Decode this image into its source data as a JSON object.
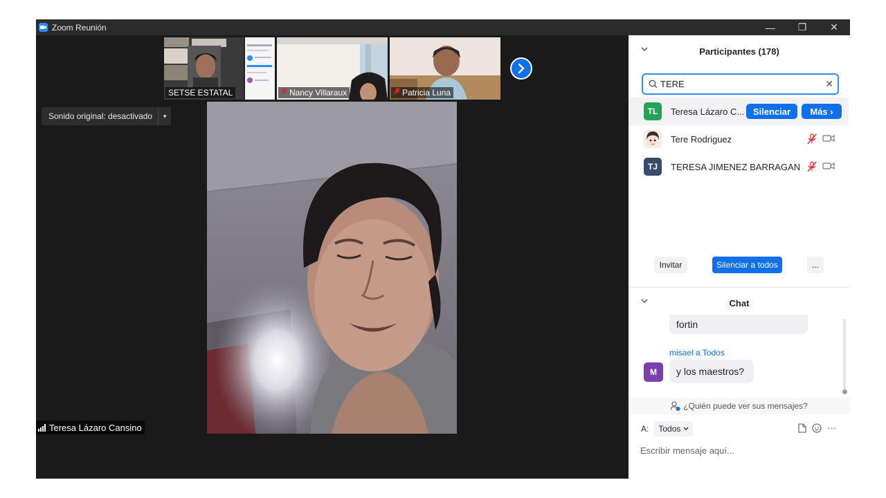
{
  "window": {
    "title": "Zoom Reunión"
  },
  "thumbnails": [
    {
      "name": "SETSE ESTATAL",
      "muted": false
    },
    {
      "name": "Nancy Villaraux",
      "muted": true
    },
    {
      "name": "Patricia Luna",
      "muted": true
    }
  ],
  "original_sound": {
    "label": "Sonido original: desactivado"
  },
  "active_speaker": {
    "name": "Teresa Lázaro Cansino"
  },
  "participants": {
    "header": "Participantes (178)",
    "search_value": "TERE",
    "list": [
      {
        "initials": "TL",
        "name": "Teresa Lázaro C...",
        "color": "#23a455"
      },
      {
        "initials": "",
        "name": "Tere Rodriguez",
        "color": "#f3e6e2"
      },
      {
        "initials": "TJ",
        "name": "TERESA JIMENEZ BARRAGAN",
        "color": "#3a4a6b"
      }
    ],
    "mute_label": "Silenciar",
    "more_label": "Más",
    "invite_label": "Invitar",
    "mute_all_label": "Silenciar a todos",
    "more_footer_label": "..."
  },
  "chat": {
    "header": "Chat",
    "messages": [
      {
        "text": "fortin"
      },
      {
        "sender": "misael a Todos",
        "initial": "M",
        "text": "y los maestros?"
      }
    ],
    "who_can_see": "¿Quién puede ver sus mensajes?",
    "to_label": "A:",
    "to_value": "Todos",
    "placeholder": "Escribir mensaje aquí..."
  },
  "colors": {
    "accent": "#0e71eb",
    "muted_mic": "#e02828",
    "avatar_m": "#7b3fb0"
  },
  "icons": {
    "window_minimize": "—",
    "window_restore": "❐",
    "window_close": "✕",
    "collapse_chevron": "⌄",
    "search": "search-icon",
    "clear": "✕",
    "next": "chevron-right-icon",
    "dropdown": "▾",
    "more_arrow": "›",
    "tools_more": "···"
  }
}
